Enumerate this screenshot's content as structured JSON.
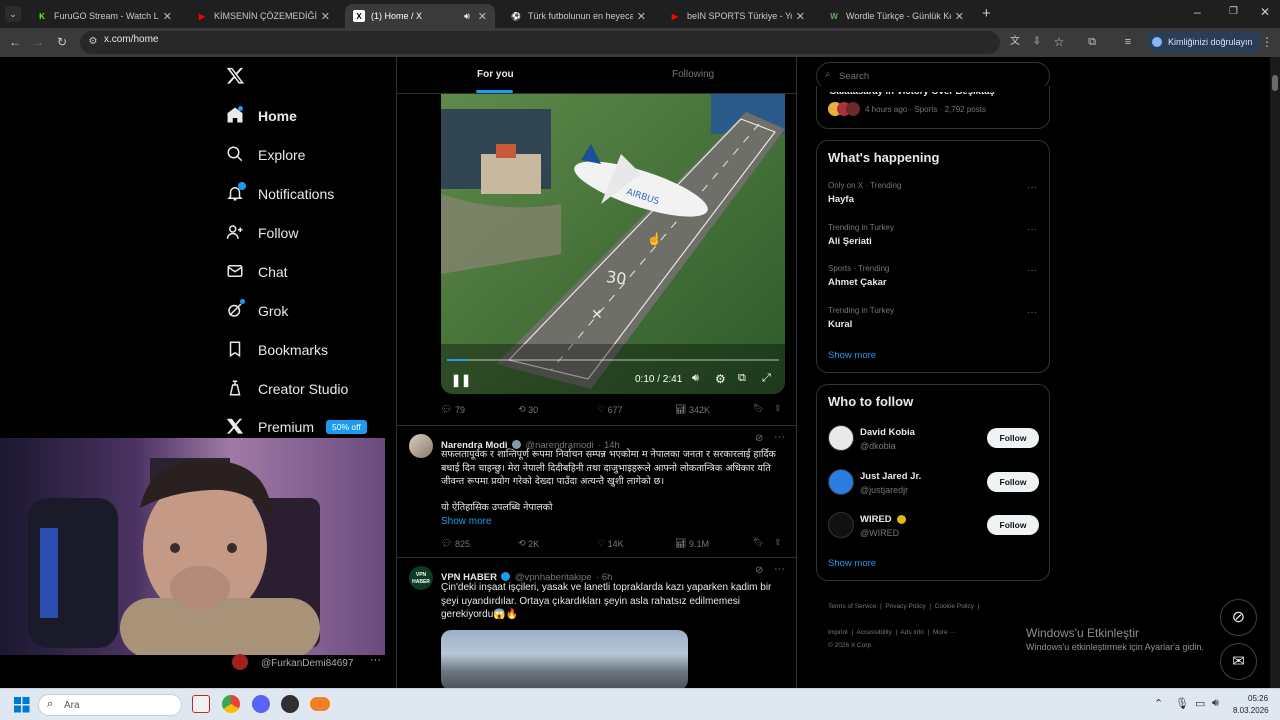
{
  "browser": {
    "tabs": [
      {
        "label": "FuruGO Stream - Watch Live on",
        "fav": "K",
        "fav_color": "#53fc18"
      },
      {
        "label": "KİMSENİN ÇÖZEMEDİĞİ TARİHİ",
        "fav": "▶",
        "fav_color": "#ff0000"
      },
      {
        "label": "(1) Home / X",
        "fav": "X",
        "fav_color": "#000000"
      },
      {
        "label": "Türk futbolunun en heyecanlı m",
        "fav": "⚽",
        "fav_color": "#2e7d32"
      },
      {
        "label": "beIN SPORTS Türkiye - YouTube",
        "fav": "▶",
        "fav_color": "#ff0000"
      },
      {
        "label": "Wordle Türkçe - Günlük Kelime",
        "fav": "W",
        "fav_color": "#6aaa64"
      }
    ],
    "url": "x.com/home",
    "verify_label": "Kimliğinizi doğrulayın"
  },
  "nav": {
    "items": [
      {
        "label": "Home",
        "icon": "home-icon"
      },
      {
        "label": "Explore",
        "icon": "search-icon"
      },
      {
        "label": "Notifications",
        "icon": "bell-icon"
      },
      {
        "label": "Follow",
        "icon": "follow-icon"
      },
      {
        "label": "Chat",
        "icon": "mail-icon"
      },
      {
        "label": "Grok",
        "icon": "grok-icon"
      },
      {
        "label": "Bookmarks",
        "icon": "bookmark-icon"
      },
      {
        "label": "Creator Studio",
        "icon": "creator-icon"
      },
      {
        "label": "Premium",
        "icon": "x-icon"
      }
    ],
    "premium_badge": "50% off",
    "account_handle": "@FurkanDemi84697"
  },
  "feed": {
    "tab_for_you": "For you",
    "tab_following": "Following",
    "video": {
      "time": "0:10 / 2:41",
      "progress": 0.062,
      "runway_label": "30"
    },
    "tweet1_actions": {
      "replies": "79",
      "reposts": "30",
      "likes": "677",
      "views": "342K"
    },
    "tweet2": {
      "name": "Narendra Modi",
      "handle": "@narendramodi",
      "time": "· 14h",
      "text": "सफलतापूर्वक र शान्तिपूर्ण रूपमा निर्वाचन सम्पन्न भएकोमा म नेपालका जनता र सरकारलाई हार्दिक बधाई दिन चाहन्छु। मेरा नेपाली दिदीबहिनी तथा दाजुभाइहरूले आफ्नो लोकतान्त्रिक अधिकार यति जीवन्त रूपमा प्रयोग गरेको देख्दा पाउँदा अत्यन्तै खुशी लागेको छ।",
      "text2": "यो ऐतिहासिक उपलब्धि नेपालको",
      "show_more": "Show more",
      "replies": "825",
      "reposts": "2K",
      "likes": "14K",
      "views": "9.1M"
    },
    "tweet3": {
      "name": "VPN HABER",
      "handle": "@vpnhaberitakipe",
      "time": "· 6h",
      "avatar_text": "VPN HABER",
      "text": "Çin'deki inşaat işçileri, yasak ve lanetli topraklarda kazı yaparken kadim bir şeyi uyandırdılar. Ortaya çıkardıkları şeyin asla rahatsız edilmemesi gerekiyordu😱🔥"
    }
  },
  "right": {
    "search_placeholder": "Search",
    "top_card": {
      "text": "Galatasaray in Victory Over Beşiktaş",
      "meta": "4 hours ago · Sports · 2,792 posts"
    },
    "whats_happening": "What's happening",
    "trends": [
      {
        "meta": "Only on X · Trending",
        "name": "Hayfa"
      },
      {
        "meta": "Trending in Turkey",
        "name": "Ali Şeriati"
      },
      {
        "meta": "Sports · Trending",
        "name": "Ahmet Çakar"
      },
      {
        "meta": "Trending in Turkey",
        "name": "Kural"
      }
    ],
    "show_more": "Show more",
    "who_to_follow": "Who to follow",
    "follow_suggestions": [
      {
        "name": "David Kobia",
        "handle": "@dkobia"
      },
      {
        "name": "Just Jared Jr.",
        "handle": "@justjaredjr"
      },
      {
        "name": "WIRED",
        "handle": "@WIRED"
      }
    ],
    "follow_label": "Follow",
    "footer": {
      "terms": "Terms of Service",
      "privacy": "Privacy Policy",
      "cookie": "Cookie Policy",
      "imprint": "Imprint",
      "accessibility": "Accessibility",
      "ads": "Ads info",
      "more": "More ···",
      "copyright": "© 2026 X Corp."
    },
    "windows_activate": "Windows'u Etkinleştir",
    "windows_activate_sub": "Windows'u etkinleştirmek için Ayarlar'a gidin."
  },
  "taskbar": {
    "search": "Ara",
    "time": "05:26",
    "date": "8.03.2026"
  },
  "colors": {
    "accent": "#1d9bf0",
    "bg": "#000000",
    "border": "#2f3336"
  }
}
